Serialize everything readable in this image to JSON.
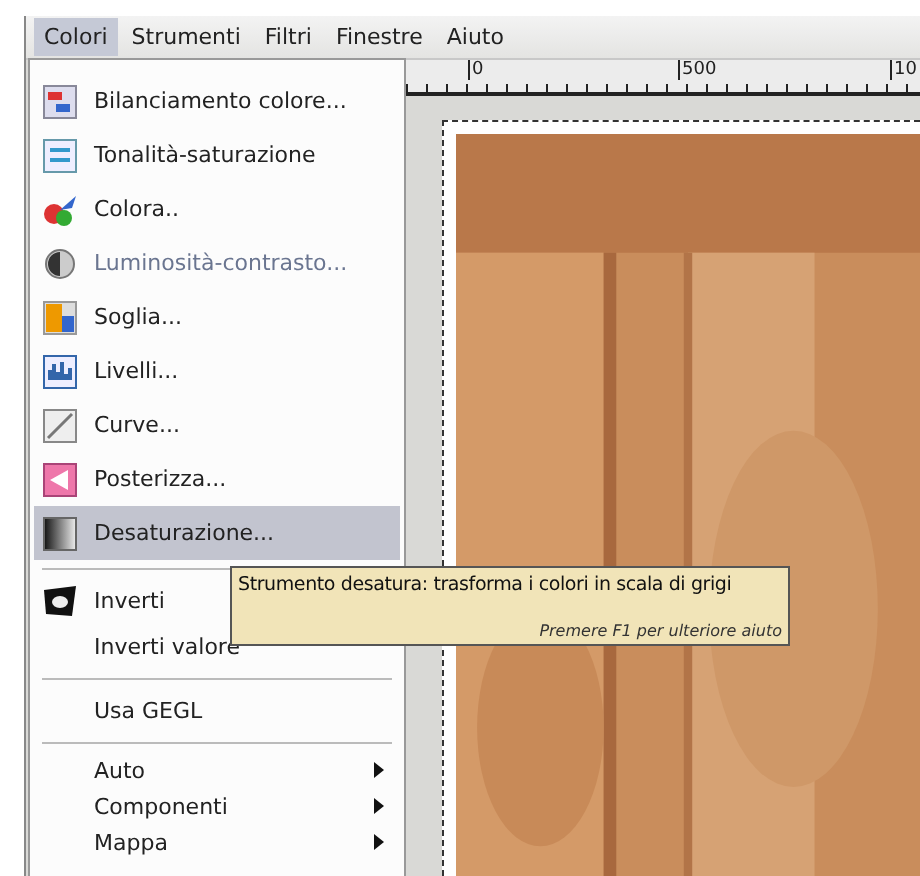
{
  "menubar": [
    {
      "label": "Colori",
      "selected": true
    },
    {
      "label": "Strumenti",
      "selected": false
    },
    {
      "label": "Filtri",
      "selected": false
    },
    {
      "label": "Finestre",
      "selected": false
    },
    {
      "label": "Aiuto",
      "selected": false
    }
  ],
  "ruler": {
    "labels": [
      "0",
      "500",
      "10"
    ]
  },
  "menu": [
    {
      "kind": "item",
      "label": "Bilanciamento colore...",
      "highlighted": false,
      "disabled": false
    },
    {
      "kind": "item",
      "label": "Tonalità-saturazione",
      "highlighted": false,
      "disabled": false
    },
    {
      "kind": "item",
      "label": "Colora..",
      "highlighted": false,
      "disabled": false
    },
    {
      "kind": "item",
      "label": "Luminosità-contrasto...",
      "highlighted": false,
      "disabled": true
    },
    {
      "kind": "item",
      "label": "Soglia...",
      "highlighted": false,
      "disabled": false
    },
    {
      "kind": "item",
      "label": "Livelli...",
      "highlighted": false,
      "disabled": false
    },
    {
      "kind": "item",
      "label": "Curve...",
      "highlighted": false,
      "disabled": false
    },
    {
      "kind": "item",
      "label": "Posterizza...",
      "highlighted": false,
      "disabled": false
    },
    {
      "kind": "item",
      "label": "Desaturazione...",
      "highlighted": true,
      "disabled": false
    },
    {
      "kind": "separator"
    },
    {
      "kind": "item",
      "label": "Inverti",
      "highlighted": false,
      "disabled": false
    },
    {
      "kind": "item",
      "label": "Inverti valore",
      "highlighted": false,
      "disabled": false
    },
    {
      "kind": "separator"
    },
    {
      "kind": "item",
      "label": "Usa GEGL",
      "highlighted": false,
      "disabled": false
    },
    {
      "kind": "separator"
    },
    {
      "kind": "submenu",
      "label": "Auto"
    },
    {
      "kind": "submenu",
      "label": "Componenti"
    },
    {
      "kind": "submenu",
      "label": "Mappa"
    }
  ],
  "tooltip": {
    "text": "Strumento desatura: trasforma i colori in scala di grigi",
    "hint": "Premere F1 per ulteriore aiuto"
  }
}
